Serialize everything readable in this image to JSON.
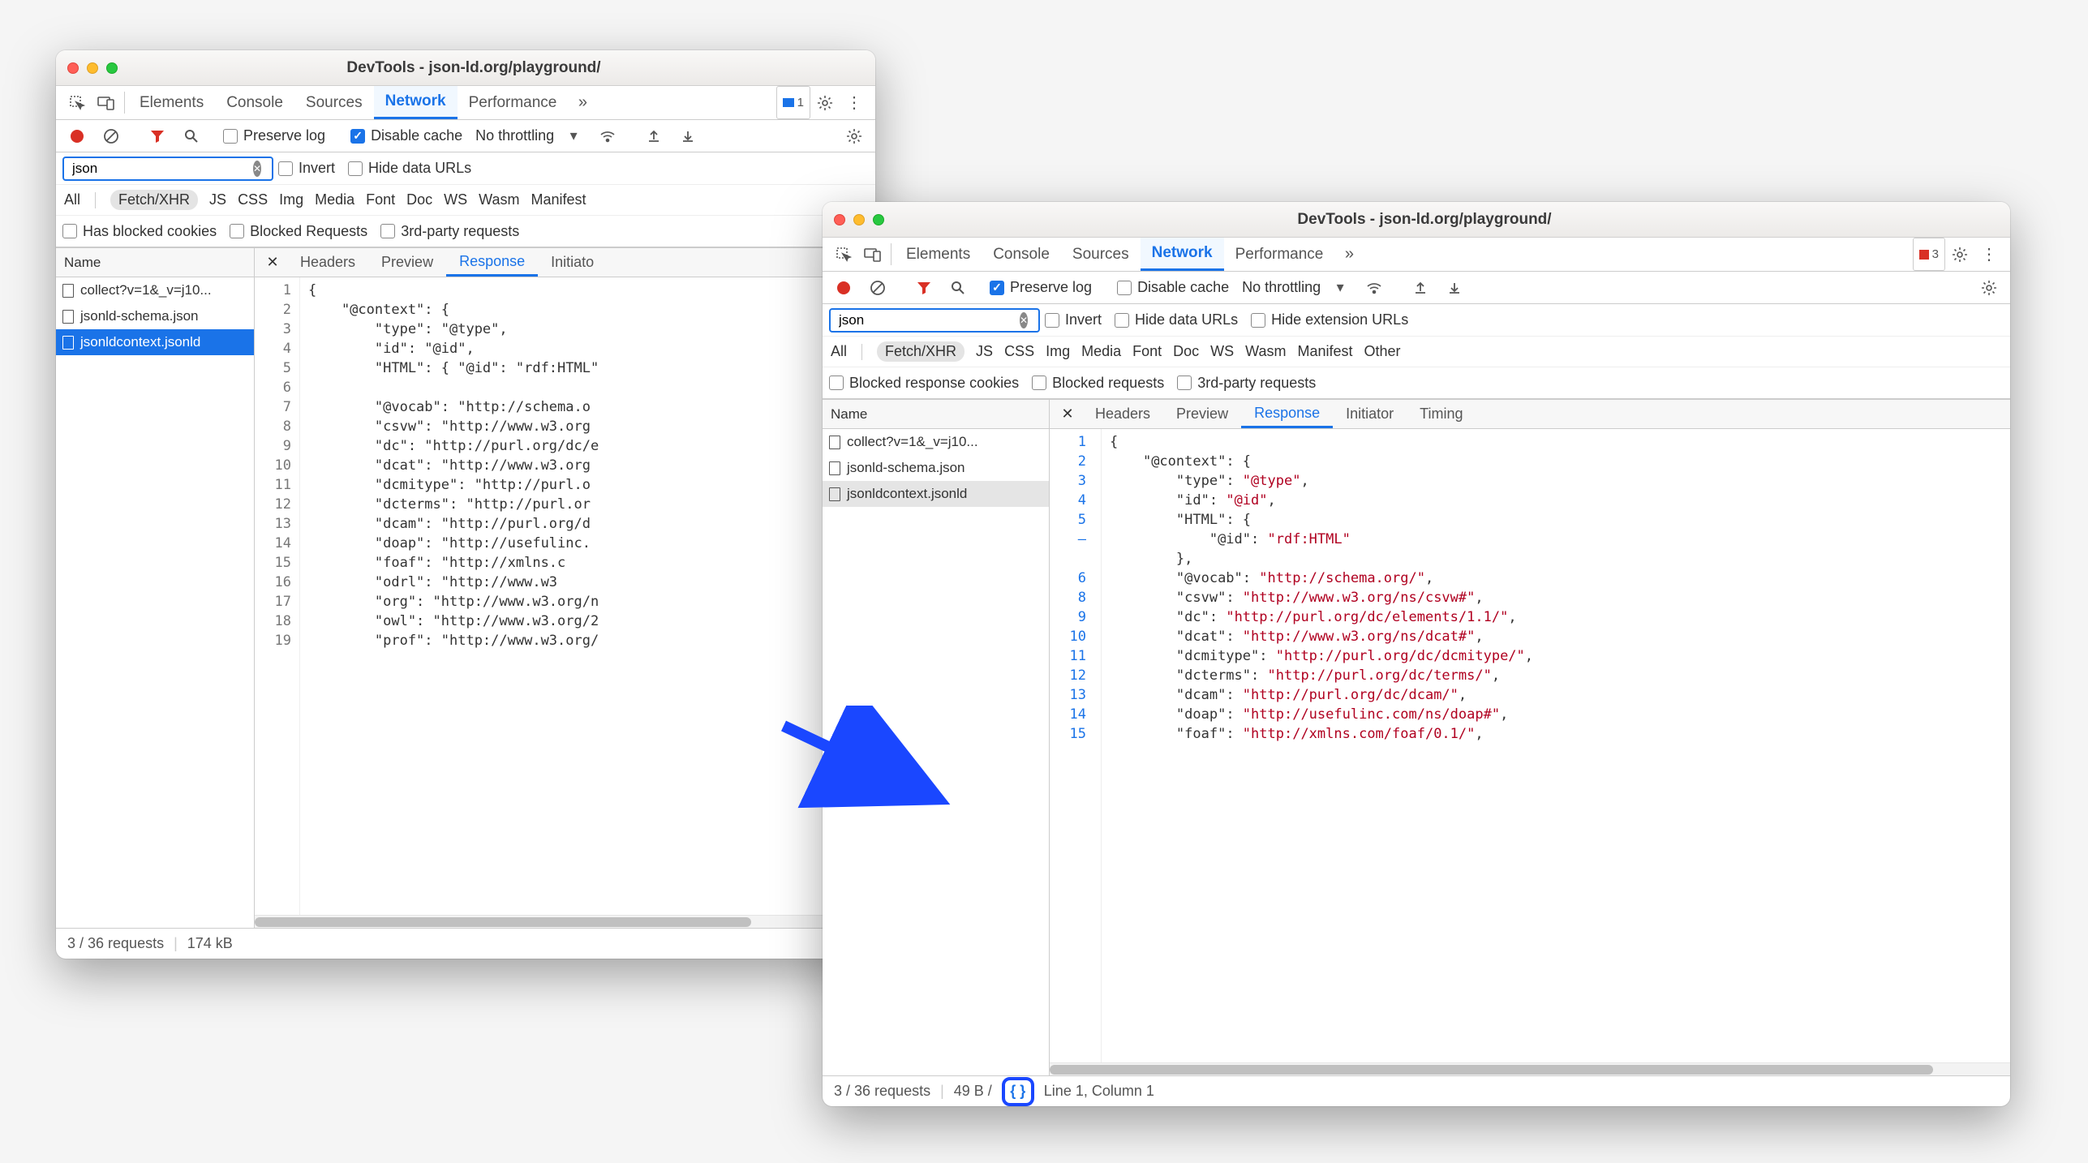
{
  "win1": {
    "title": "DevTools - json-ld.org/playground/",
    "tabs": [
      "Elements",
      "Console",
      "Sources",
      "Network",
      "Performance"
    ],
    "activeTab": "Network",
    "badge": {
      "type": "msg",
      "count": "1"
    },
    "toolbar": {
      "preserve_log": {
        "label": "Preserve log",
        "checked": false
      },
      "disable_cache": {
        "label": "Disable cache",
        "checked": true
      },
      "throttling": "No throttling"
    },
    "filter": {
      "value": "json"
    },
    "invert": {
      "label": "Invert",
      "checked": false
    },
    "hide_data_urls": {
      "label": "Hide data URLs",
      "checked": false
    },
    "types": [
      "All",
      "Fetch/XHR",
      "JS",
      "CSS",
      "Img",
      "Media",
      "Font",
      "Doc",
      "WS",
      "Wasm",
      "Manifest"
    ],
    "activeType": "Fetch/XHR",
    "extra": {
      "blocked_cookies": {
        "label": "Has blocked cookies",
        "checked": false
      },
      "blocked_requests": {
        "label": "Blocked Requests",
        "checked": false
      },
      "third_party": {
        "label": "3rd-party requests",
        "checked": false
      }
    },
    "name_header": "Name",
    "requests": [
      {
        "name": "collect?v=1&_v=j10...",
        "sel": false
      },
      {
        "name": "jsonld-schema.json",
        "sel": false
      },
      {
        "name": "jsonldcontext.jsonld",
        "sel": true
      }
    ],
    "detail_tabs": [
      "Headers",
      "Preview",
      "Response",
      "Initiato"
    ],
    "detail_active": "Response",
    "code_gutter": [
      "1",
      "2",
      "3",
      "4",
      "5",
      "6",
      "7",
      "8",
      "9",
      "10",
      "11",
      "12",
      "13",
      "14",
      "15",
      "16",
      "17",
      "18",
      "19"
    ],
    "code_lines": [
      "{",
      "    \"@context\": {",
      "        \"type\": \"@type\",",
      "        \"id\": \"@id\",",
      "        \"HTML\": { \"@id\": \"rdf:HTML\"",
      "",
      "        \"@vocab\": \"http://schema.o",
      "        \"csvw\": \"http://www.w3.org",
      "        \"dc\": \"http://purl.org/dc/e",
      "        \"dcat\": \"http://www.w3.org",
      "        \"dcmitype\": \"http://purl.o",
      "        \"dcterms\": \"http://purl.or",
      "        \"dcam\": \"http://purl.org/d",
      "        \"doap\": \"http://usefulinc.",
      "        \"foaf\": \"http://xmlns.c",
      "        \"odrl\": \"http://www.w3",
      "        \"org\": \"http://www.w3.org/n",
      "        \"owl\": \"http://www.w3.org/2",
      "        \"prof\": \"http://www.w3.org/"
    ],
    "status": {
      "requests": "3 / 36 requests",
      "size": "174 kB"
    }
  },
  "win2": {
    "title": "DevTools - json-ld.org/playground/",
    "tabs": [
      "Elements",
      "Console",
      "Sources",
      "Network",
      "Performance"
    ],
    "activeTab": "Network",
    "badge": {
      "type": "err",
      "count": "3"
    },
    "toolbar": {
      "preserve_log": {
        "label": "Preserve log",
        "checked": true
      },
      "disable_cache": {
        "label": "Disable cache",
        "checked": false
      },
      "throttling": "No throttling"
    },
    "filter": {
      "value": "json"
    },
    "invert": {
      "label": "Invert",
      "checked": false
    },
    "hide_data_urls": {
      "label": "Hide data URLs",
      "checked": false
    },
    "hide_ext_urls": {
      "label": "Hide extension URLs",
      "checked": false
    },
    "types": [
      "All",
      "Fetch/XHR",
      "JS",
      "CSS",
      "Img",
      "Media",
      "Font",
      "Doc",
      "WS",
      "Wasm",
      "Manifest",
      "Other"
    ],
    "activeType": "Fetch/XHR",
    "extra": {
      "blocked_cookies": {
        "label": "Blocked response cookies",
        "checked": false
      },
      "blocked_requests": {
        "label": "Blocked requests",
        "checked": false
      },
      "third_party": {
        "label": "3rd-party requests",
        "checked": false
      }
    },
    "name_header": "Name",
    "requests": [
      {
        "name": "collect?v=1&_v=j10...",
        "sel": false
      },
      {
        "name": "jsonld-schema.json",
        "sel": false
      },
      {
        "name": "jsonldcontext.jsonld",
        "sel": "light"
      }
    ],
    "detail_tabs": [
      "Headers",
      "Preview",
      "Response",
      "Initiator",
      "Timing"
    ],
    "detail_active": "Response",
    "code_gutter": [
      "1",
      "2",
      "3",
      "4",
      "5",
      "–",
      "",
      "6",
      "8",
      "9",
      "10",
      "11",
      "12",
      "13",
      "14",
      "15"
    ],
    "code_lines": [
      {
        "t": "{"
      },
      {
        "i": 4,
        "k": "\"@context\"",
        "p": ": {"
      },
      {
        "i": 8,
        "k": "\"type\"",
        "p": ": ",
        "v": "\"@type\"",
        "e": ","
      },
      {
        "i": 8,
        "k": "\"id\"",
        "p": ": ",
        "v": "\"@id\"",
        "e": ","
      },
      {
        "i": 8,
        "k": "\"HTML\"",
        "p": ": {"
      },
      {
        "i": 12,
        "k": "\"@id\"",
        "p": ": ",
        "v": "\"rdf:HTML\""
      },
      {
        "i": 8,
        "t": "},"
      },
      {
        "i": 8,
        "k": "\"@vocab\"",
        "p": ": ",
        "v": "\"http://schema.org/\"",
        "e": ","
      },
      {
        "i": 8,
        "k": "\"csvw\"",
        "p": ": ",
        "v": "\"http://www.w3.org/ns/csvw#\"",
        "e": ","
      },
      {
        "i": 8,
        "k": "\"dc\"",
        "p": ": ",
        "v": "\"http://purl.org/dc/elements/1.1/\"",
        "e": ","
      },
      {
        "i": 8,
        "k": "\"dcat\"",
        "p": ": ",
        "v": "\"http://www.w3.org/ns/dcat#\"",
        "e": ","
      },
      {
        "i": 8,
        "k": "\"dcmitype\"",
        "p": ": ",
        "v": "\"http://purl.org/dc/dcmitype/\"",
        "e": ","
      },
      {
        "i": 8,
        "k": "\"dcterms\"",
        "p": ": ",
        "v": "\"http://purl.org/dc/terms/\"",
        "e": ","
      },
      {
        "i": 8,
        "k": "\"dcam\"",
        "p": ": ",
        "v": "\"http://purl.org/dc/dcam/\"",
        "e": ","
      },
      {
        "i": 8,
        "k": "\"doap\"",
        "p": ": ",
        "v": "\"http://usefulinc.com/ns/doap#\"",
        "e": ","
      },
      {
        "i": 8,
        "k": "\"foaf\"",
        "p": ": ",
        "v": "\"http://xmlns.com/foaf/0.1/\"",
        "e": ","
      }
    ],
    "status": {
      "requests": "3 / 36 requests",
      "size": "49 B /",
      "cursor": "Line 1, Column 1"
    }
  }
}
